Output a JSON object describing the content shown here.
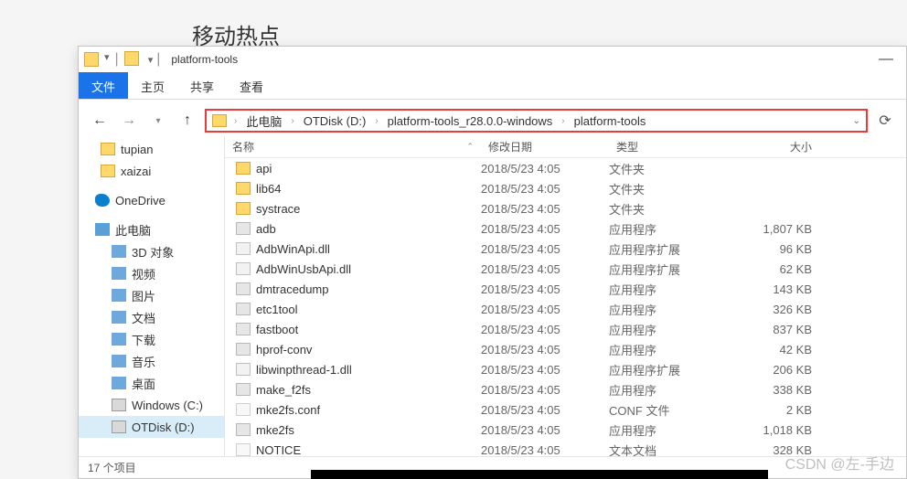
{
  "bg_heading": "移动热点",
  "titlebar": {
    "title": "platform-tools",
    "minimize": "—"
  },
  "ribbon": {
    "file": "文件",
    "home": "主页",
    "share": "共享",
    "view": "查看"
  },
  "breadcrumb": {
    "items": [
      "此电脑",
      "OTDisk (D:)",
      "platform-tools_r28.0.0-windows",
      "platform-tools"
    ]
  },
  "sidebar": {
    "tupian": "tupian",
    "xaizai": "xaizai",
    "onedrive": "OneDrive",
    "this_pc": "此电脑",
    "threed": "3D 对象",
    "video": "视频",
    "pictures": "图片",
    "documents": "文档",
    "downloads": "下载",
    "music": "音乐",
    "desktop": "桌面",
    "windows_c": "Windows (C:)",
    "otdisk": "OTDisk (D:)"
  },
  "columns": {
    "name": "名称",
    "modified": "修改日期",
    "type": "类型",
    "size": "大小"
  },
  "files": [
    {
      "name": "api",
      "date": "2018/5/23 4:05",
      "type": "文件夹",
      "size": "",
      "icon": "folder"
    },
    {
      "name": "lib64",
      "date": "2018/5/23 4:05",
      "type": "文件夹",
      "size": "",
      "icon": "folder"
    },
    {
      "name": "systrace",
      "date": "2018/5/23 4:05",
      "type": "文件夹",
      "size": "",
      "icon": "folder"
    },
    {
      "name": "adb",
      "date": "2018/5/23 4:05",
      "type": "应用程序",
      "size": "1,807 KB",
      "icon": "exe"
    },
    {
      "name": "AdbWinApi.dll",
      "date": "2018/5/23 4:05",
      "type": "应用程序扩展",
      "size": "96 KB",
      "icon": "dll"
    },
    {
      "name": "AdbWinUsbApi.dll",
      "date": "2018/5/23 4:05",
      "type": "应用程序扩展",
      "size": "62 KB",
      "icon": "dll"
    },
    {
      "name": "dmtracedump",
      "date": "2018/5/23 4:05",
      "type": "应用程序",
      "size": "143 KB",
      "icon": "exe"
    },
    {
      "name": "etc1tool",
      "date": "2018/5/23 4:05",
      "type": "应用程序",
      "size": "326 KB",
      "icon": "exe"
    },
    {
      "name": "fastboot",
      "date": "2018/5/23 4:05",
      "type": "应用程序",
      "size": "837 KB",
      "icon": "exe"
    },
    {
      "name": "hprof-conv",
      "date": "2018/5/23 4:05",
      "type": "应用程序",
      "size": "42 KB",
      "icon": "exe"
    },
    {
      "name": "libwinpthread-1.dll",
      "date": "2018/5/23 4:05",
      "type": "应用程序扩展",
      "size": "206 KB",
      "icon": "dll"
    },
    {
      "name": "make_f2fs",
      "date": "2018/5/23 4:05",
      "type": "应用程序",
      "size": "338 KB",
      "icon": "exe"
    },
    {
      "name": "mke2fs.conf",
      "date": "2018/5/23 4:05",
      "type": "CONF 文件",
      "size": "2 KB",
      "icon": "txt"
    },
    {
      "name": "mke2fs",
      "date": "2018/5/23 4:05",
      "type": "应用程序",
      "size": "1,018 KB",
      "icon": "exe"
    },
    {
      "name": "NOTICE",
      "date": "2018/5/23 4:05",
      "type": "文本文档",
      "size": "328 KB",
      "icon": "txt"
    }
  ],
  "status": {
    "count": "17 个项目"
  },
  "watermark": "CSDN @左-手边"
}
